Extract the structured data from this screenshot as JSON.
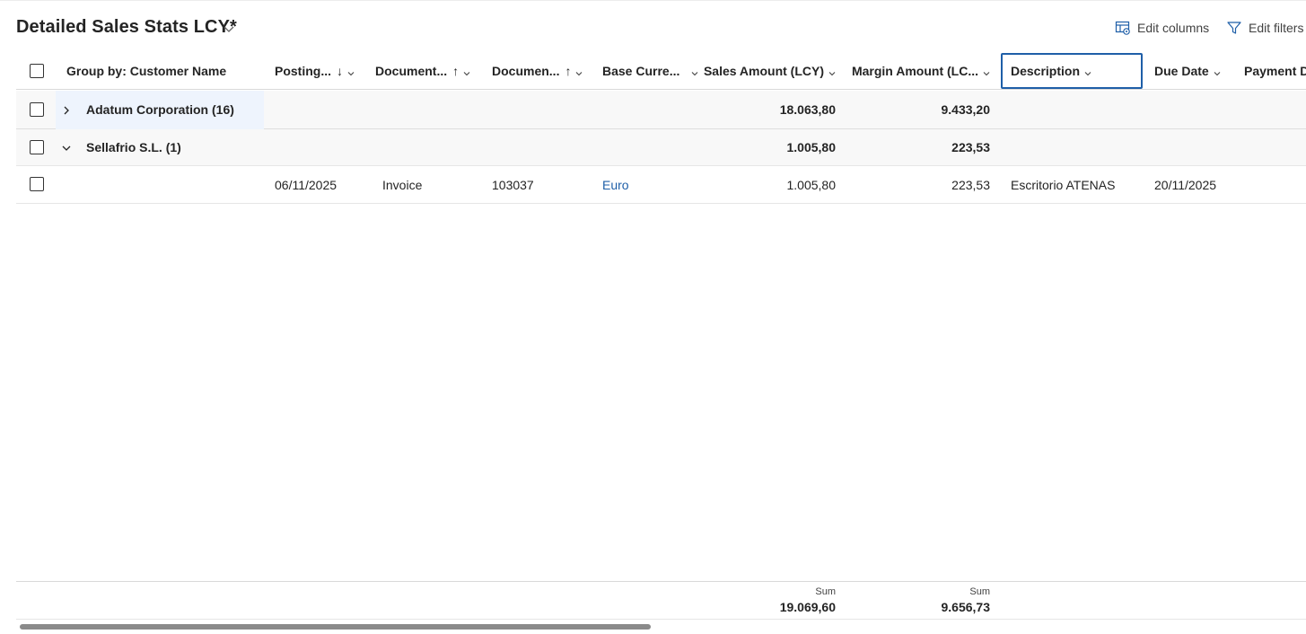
{
  "page": {
    "title": "Detailed Sales Stats LCY*"
  },
  "toolbar": {
    "edit_columns": "Edit columns",
    "edit_filters": "Edit filters"
  },
  "columns": {
    "group_by": "Group by: Customer Name",
    "posting": "Posting...",
    "posting_sort": "↓",
    "document_type": "Document...",
    "document_type_sort": "↑",
    "document_no": "Documen...",
    "document_no_sort": "↑",
    "base_currency": "Base Curre...",
    "sales_amount": "Sales Amount (LCY)",
    "margin_amount": "Margin Amount (LC...",
    "description": "Description",
    "due_date": "Due Date",
    "payment": "Payment D"
  },
  "groups": [
    {
      "name": "Adatum Corporation (16)",
      "sales_amount": "18.063,80",
      "margin_amount": "9.433,20",
      "expanded": false
    },
    {
      "name": "Sellafrio S.L. (1)",
      "sales_amount": "1.005,80",
      "margin_amount": "223,53",
      "expanded": true
    }
  ],
  "rows": [
    {
      "posting_date": "06/11/2025",
      "document_type": "Invoice",
      "document_no": "103037",
      "base_currency": "Euro",
      "sales_amount": "1.005,80",
      "margin_amount": "223,53",
      "description": "Escritorio ATENAS",
      "due_date": "20/11/2025"
    }
  ],
  "footer": {
    "sales_label": "Sum",
    "sales_sum": "19.069,60",
    "margin_label": "Sum",
    "margin_sum": "9.656,73"
  },
  "icons": {
    "title_menu": "chevron-down-icon",
    "edit_columns": "table-settings-icon",
    "edit_filters": "filter-icon",
    "group_collapsed": "chevron-right-icon",
    "group_expanded": "chevron-down-icon"
  },
  "colors": {
    "accent": "#1f5fa8",
    "group_row_bg": "#f8f8f8",
    "selected_cell_bg": "#eef4fd"
  }
}
